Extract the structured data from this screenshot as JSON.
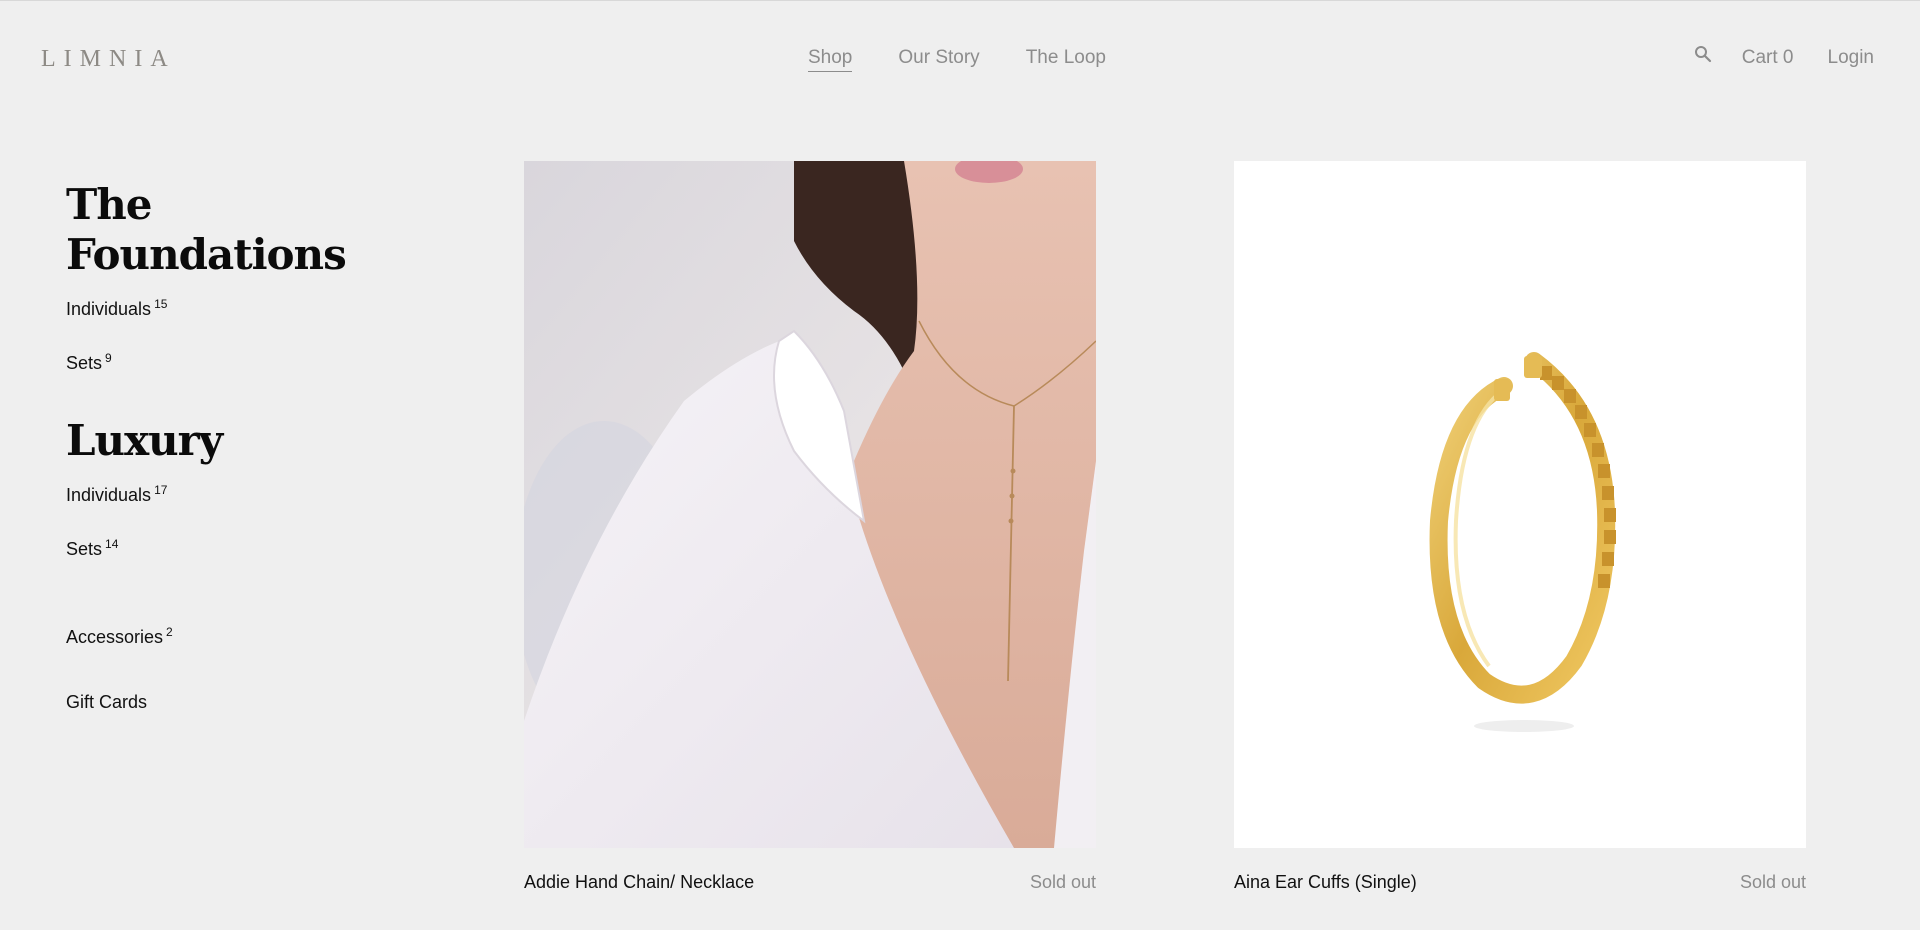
{
  "header": {
    "logo": "LIMNIA",
    "nav": [
      "Shop",
      "Our Story",
      "The Loop"
    ],
    "active_nav": "Shop",
    "cart_label": "Cart",
    "cart_count": "0",
    "login_label": "Login",
    "search_icon": "search-icon"
  },
  "sidebar": {
    "groups": [
      {
        "title": "The Foundations",
        "items": [
          {
            "label": "Individuals",
            "count": "15"
          },
          {
            "label": "Sets",
            "count": "9"
          }
        ]
      },
      {
        "title": "Luxury",
        "items": [
          {
            "label": "Individuals",
            "count": "17"
          },
          {
            "label": "Sets",
            "count": "14"
          }
        ]
      }
    ],
    "extra": [
      {
        "label": "Accessories",
        "count": "2"
      },
      {
        "label": "Gift Cards",
        "count": ""
      }
    ]
  },
  "products": [
    {
      "name": "Addie Hand Chain/ Necklace",
      "status": "Sold out",
      "image": "model wearing gold lariat necklace with white shirt"
    },
    {
      "name": "Aina Ear Cuffs (Single)",
      "status": "Sold out",
      "image": "gold studded ear cuff"
    }
  ],
  "colors": {
    "background": "#efefef",
    "muted_text": "#8c8c8c",
    "gold": "#d9a83a"
  }
}
